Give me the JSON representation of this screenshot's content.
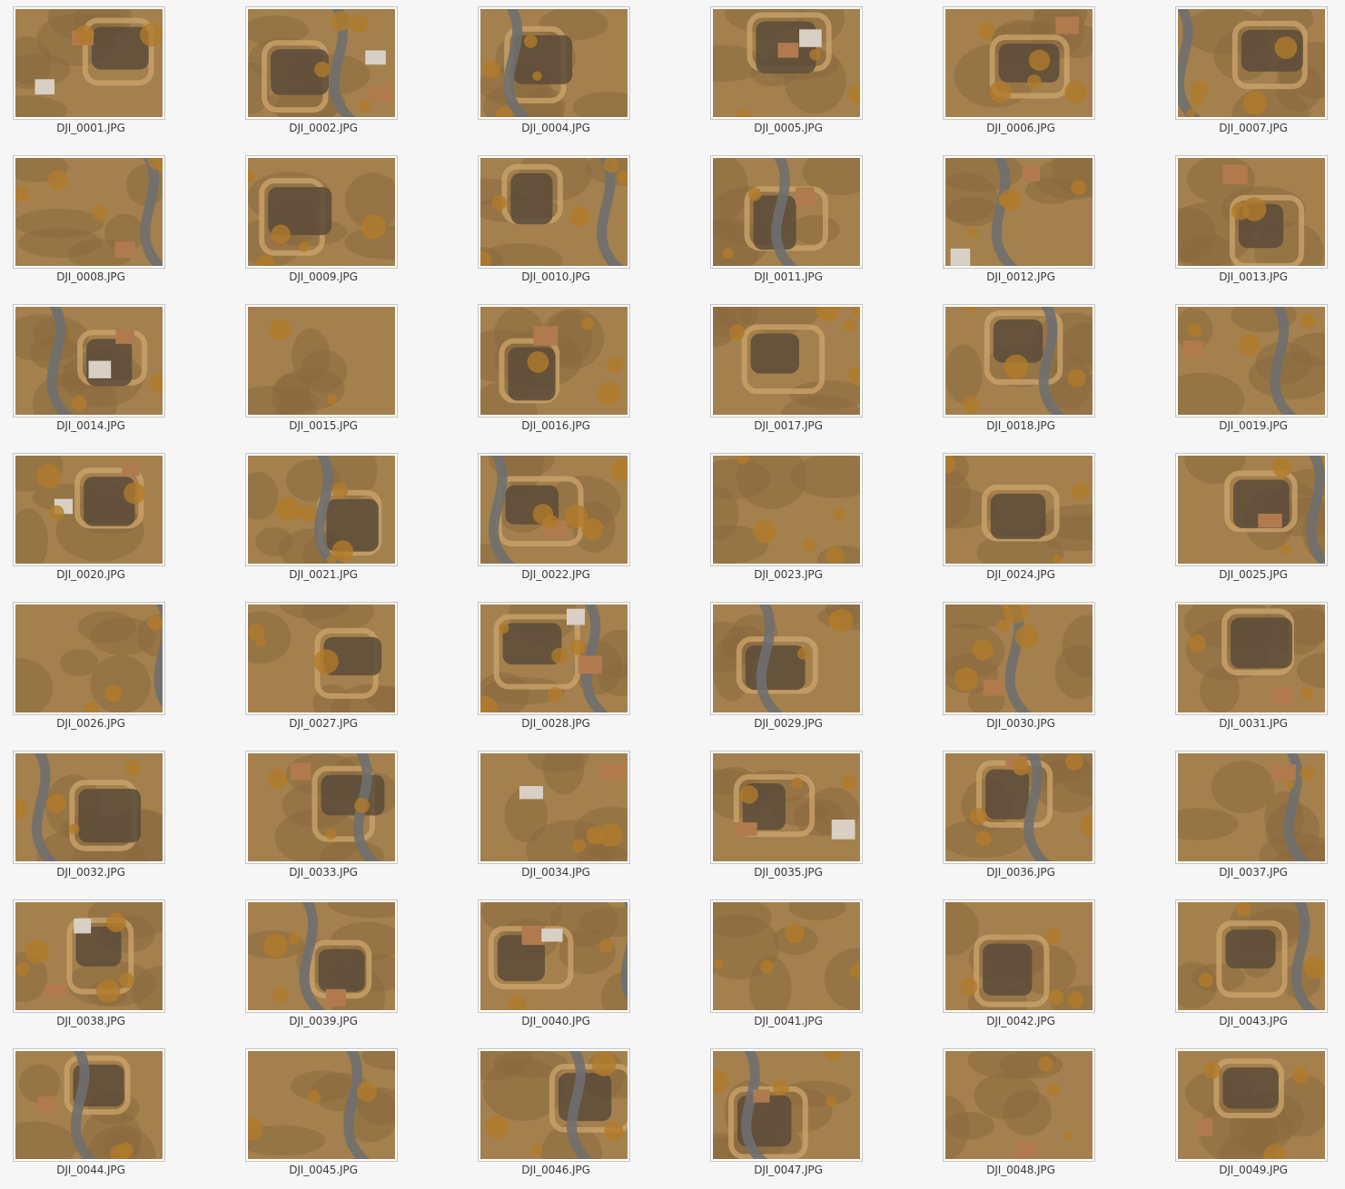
{
  "window": {
    "title": ""
  },
  "files": [
    {
      "name": "DJI_0001.JPG"
    },
    {
      "name": "DJI_0002.JPG"
    },
    {
      "name": "DJI_0004.JPG"
    },
    {
      "name": "DJI_0005.JPG"
    },
    {
      "name": "DJI_0006.JPG"
    },
    {
      "name": "DJI_0007.JPG"
    },
    {
      "name": "DJI_0008.JPG"
    },
    {
      "name": "DJI_0009.JPG"
    },
    {
      "name": "DJI_0010.JPG"
    },
    {
      "name": "DJI_0011.JPG"
    },
    {
      "name": "DJI_0012.JPG"
    },
    {
      "name": "DJI_0013.JPG"
    },
    {
      "name": "DJI_0014.JPG"
    },
    {
      "name": "DJI_0015.JPG"
    },
    {
      "name": "DJI_0016.JPG"
    },
    {
      "name": "DJI_0017.JPG"
    },
    {
      "name": "DJI_0018.JPG"
    },
    {
      "name": "DJI_0019.JPG"
    },
    {
      "name": "DJI_0020.JPG"
    },
    {
      "name": "DJI_0021.JPG"
    },
    {
      "name": "DJI_0022.JPG"
    },
    {
      "name": "DJI_0023.JPG"
    },
    {
      "name": "DJI_0024.JPG"
    },
    {
      "name": "DJI_0025.JPG"
    },
    {
      "name": "DJI_0026.JPG"
    },
    {
      "name": "DJI_0027.JPG"
    },
    {
      "name": "DJI_0028.JPG"
    },
    {
      "name": "DJI_0029.JPG"
    },
    {
      "name": "DJI_0030.JPG"
    },
    {
      "name": "DJI_0031.JPG"
    },
    {
      "name": "DJI_0032.JPG"
    },
    {
      "name": "DJI_0033.JPG"
    },
    {
      "name": "DJI_0034.JPG"
    },
    {
      "name": "DJI_0035.JPG"
    },
    {
      "name": "DJI_0036.JPG"
    },
    {
      "name": "DJI_0037.JPG"
    },
    {
      "name": "DJI_0038.JPG"
    },
    {
      "name": "DJI_0039.JPG"
    },
    {
      "name": "DJI_0040.JPG"
    },
    {
      "name": "DJI_0041.JPG"
    },
    {
      "name": "DJI_0042.JPG"
    },
    {
      "name": "DJI_0043.JPG"
    },
    {
      "name": "DJI_0044.JPG"
    },
    {
      "name": "DJI_0045.JPG"
    },
    {
      "name": "DJI_0046.JPG"
    },
    {
      "name": "DJI_0047.JPG"
    },
    {
      "name": "DJI_0048.JPG"
    },
    {
      "name": "DJI_0049.JPG"
    }
  ],
  "colors": {
    "background": "#f6f6f6",
    "thumb_border": "#c4c4c4",
    "label_text": "#3a3a3a",
    "earth": "#8a6a40",
    "dry_grass": "#a3804d",
    "pond": "#5a4b3a",
    "road": "#6f6f6f",
    "roof": "#b07a4e",
    "foliage": "#b07a2a"
  }
}
